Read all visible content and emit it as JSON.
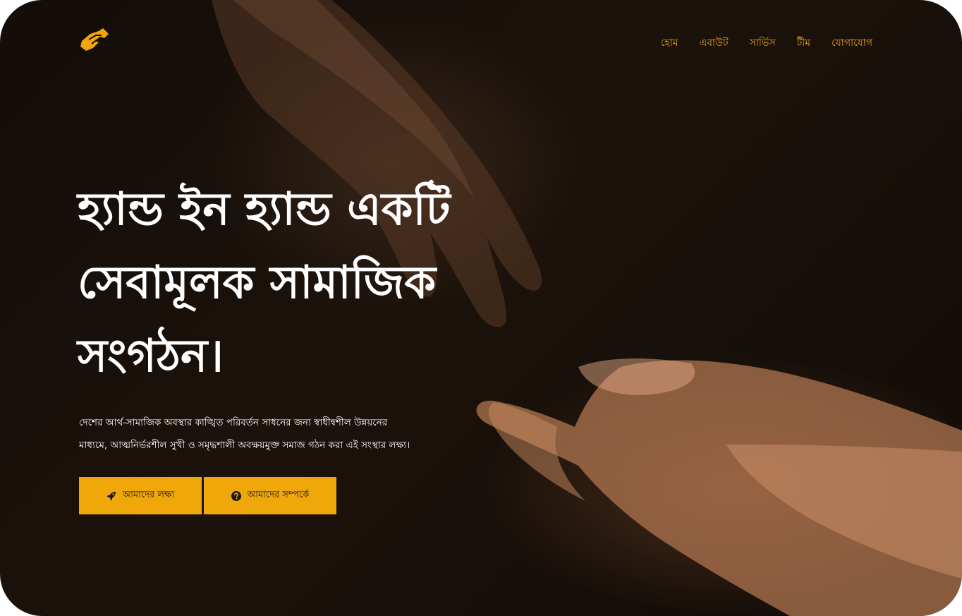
{
  "brand": {
    "logo_icon": "handshake-icon",
    "accent_color": "#f0a70a"
  },
  "nav": {
    "items": [
      {
        "label": "হোম"
      },
      {
        "label": "এবাউট"
      },
      {
        "label": "সার্ভিস"
      },
      {
        "label": "টীম"
      },
      {
        "label": "যোগাযোগ"
      }
    ]
  },
  "hero": {
    "headline": "হ্যান্ড ইন হ্যান্ড একটি সেবামূলক সামাজিক সংগঠন।",
    "description": "দেশের আর্থ-সামাজিক অবস্থার কাঙ্খিত পরিবর্তন সাধনের জন্য স্বাধীন্বশীল উন্নয়নের মাধ্যমে, আত্মনির্ভরশীল সুখী ও সমৃদ্ধশালী অবক্ষয়মুক্ত সমাজ গঠন করা এই সংস্থার লক্ষ্য।",
    "buttons": [
      {
        "label": "আমাদের লক্ষ্য",
        "icon": "rocket-icon"
      },
      {
        "label": "আমাদের সম্পর্কে",
        "icon": "question-circle-icon"
      }
    ]
  }
}
